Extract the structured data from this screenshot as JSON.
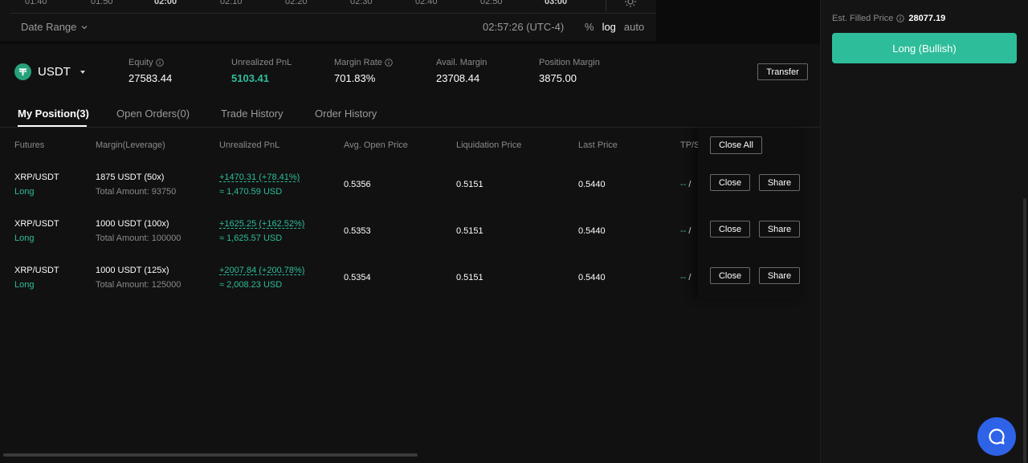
{
  "chart": {
    "time_ticks": [
      "01:40",
      "01:50",
      "02:00",
      "02:10",
      "02:20",
      "02:30",
      "02:40",
      "02:50",
      "03:00"
    ],
    "date_range_label": "Date Range",
    "clock": "02:57:26 (UTC-4)",
    "scale_buttons": [
      "%",
      "log",
      "auto"
    ],
    "active_scale": "log"
  },
  "account": {
    "currency": "USDT",
    "stats": [
      {
        "label": "Equity",
        "value": "27583.44",
        "info": true
      },
      {
        "label": "Unrealized PnL",
        "value": "5103.41",
        "info": false,
        "color": "#2ebd9a"
      },
      {
        "label": "Margin Rate",
        "value": "701.83%",
        "info": true
      },
      {
        "label": "Avail. Margin",
        "value": "23708.44",
        "info": false
      },
      {
        "label": "Position Margin",
        "value": "3875.00",
        "info": false
      }
    ],
    "transfer_label": "Transfer"
  },
  "tabs": [
    "My Position(3)",
    "Open Orders(0)",
    "Trade History",
    "Order History"
  ],
  "table": {
    "headers": [
      "Futures",
      "Margin(Leverage)",
      "Unrealized PnL",
      "Avg. Open Price",
      "Liquidation Price",
      "Last Price",
      "TP/S"
    ],
    "close_all_label": "Close All",
    "close_label": "Close",
    "share_label": "Share",
    "rows": [
      {
        "symbol": "XRP/USDT",
        "side": "Long",
        "margin": "1875 USDT (50x)",
        "total": "Total Amount: 93750",
        "pnl": "+1470.31 (+78.41%)",
        "pnl_usd": "≈ 1,470.59 USD",
        "open_price": "0.5356",
        "liq_price": "0.5151",
        "last_price": "0.5440",
        "tp": "-- ",
        "sl": "/ "
      },
      {
        "symbol": "XRP/USDT",
        "side": "Long",
        "margin": "1000 USDT (100x)",
        "total": "Total Amount: 100000",
        "pnl": "+1625.25 (+162.52%)",
        "pnl_usd": "≈ 1,625.57 USD",
        "open_price": "0.5353",
        "liq_price": "0.5151",
        "last_price": "0.5440",
        "tp": "-- ",
        "sl": "/"
      },
      {
        "symbol": "XRP/USDT",
        "side": "Long",
        "margin": "1000 USDT (125x)",
        "total": "Total Amount: 125000",
        "pnl": "+2007.84 (+200.78%)",
        "pnl_usd": "≈ 2,008.23 USD",
        "open_price": "0.5354",
        "liq_price": "0.5151",
        "last_price": "0.5440",
        "tp": "-- ",
        "sl": "/"
      }
    ]
  },
  "sidebar": {
    "est_label": "Est. Filled Price",
    "est_price": "28077.19",
    "long_label": "Long (Bullish)"
  },
  "colors": {
    "green": "#2ebd9a",
    "chat": "#2e63e8",
    "bg": "#111111"
  }
}
